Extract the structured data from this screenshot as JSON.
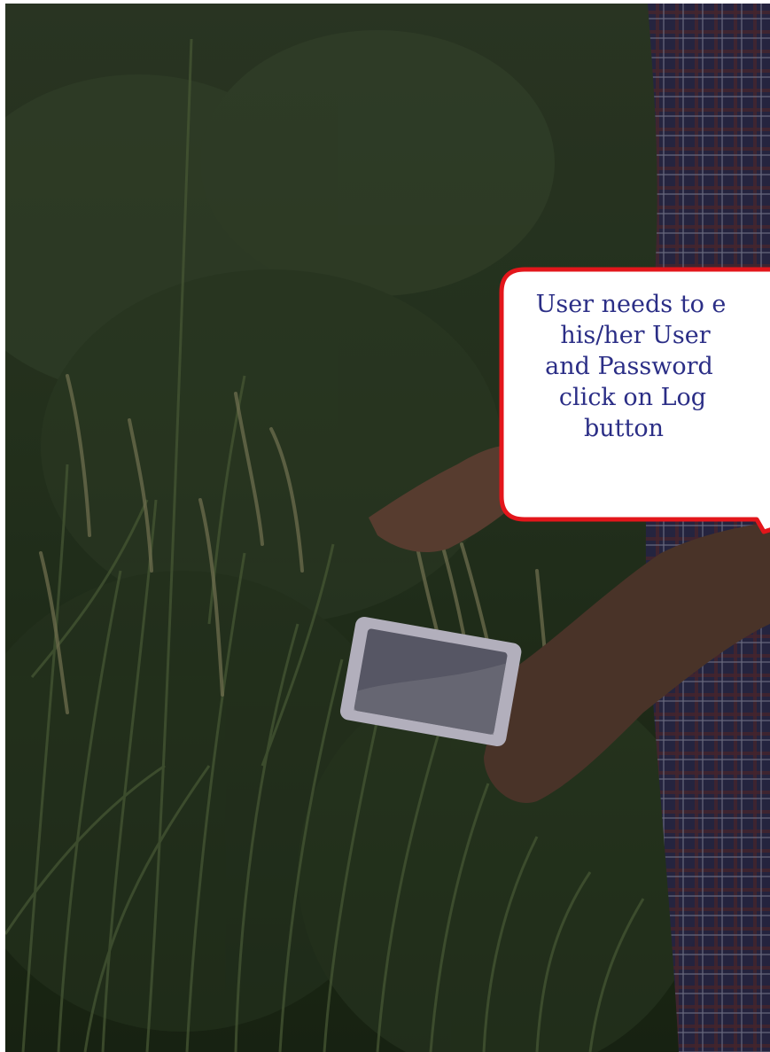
{
  "tooltip": {
    "lines": [
      "User needs to e",
      "his/her User",
      "and Password",
      "click on Log",
      "button"
    ],
    "text_color": "#2b2e86",
    "border_color": "#e3161b",
    "background_color": "#ffffff"
  },
  "background": {
    "description_icon": "farmer-with-tablet-in-rice-field-photo",
    "overlay_color": "#000000"
  }
}
